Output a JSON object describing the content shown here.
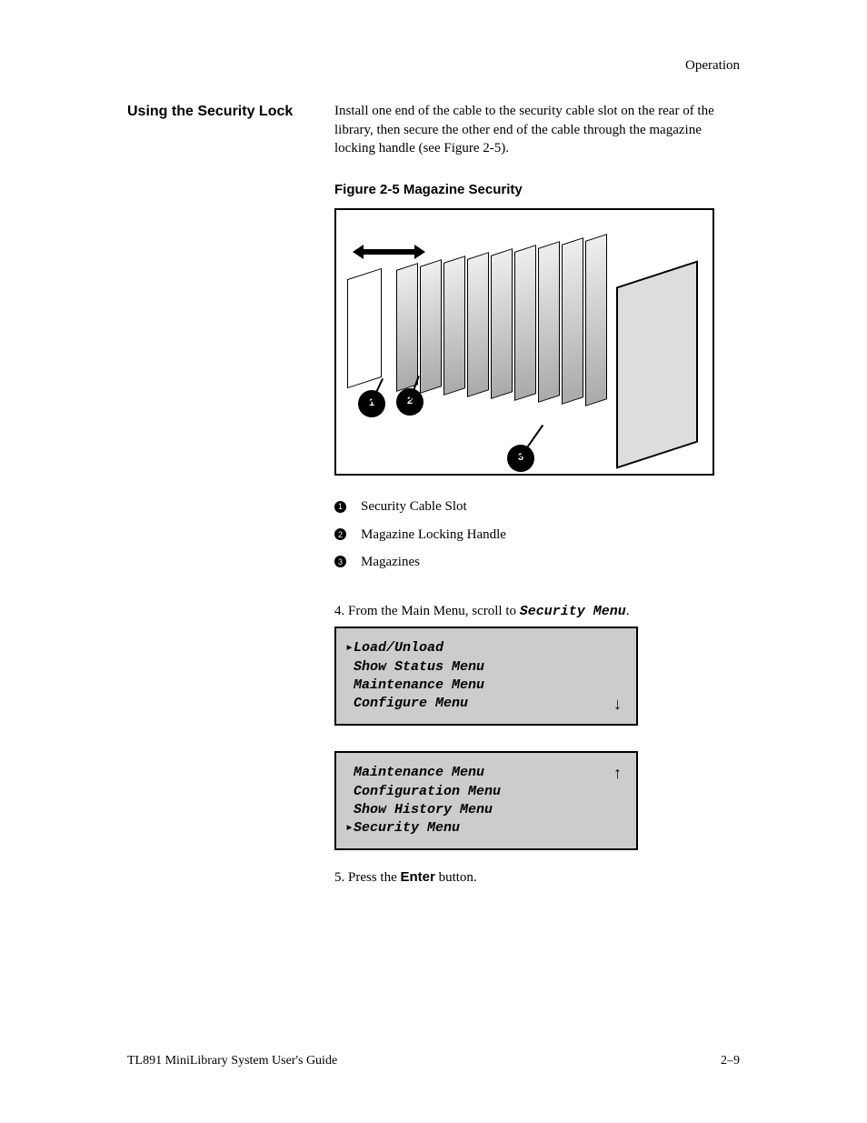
{
  "header": {
    "running_title": "Operation"
  },
  "intro": {
    "heading": "Using the Security Lock",
    "text": "Install one end of the cable to the security cable slot on the rear of the library, then secure the other end of the cable through the magazine locking handle (see Figure 2-5)."
  },
  "figure": {
    "caption": "Figure 2-5 Magazine Security",
    "callouts": [
      {
        "n": "1",
        "label": "Security Cable Slot"
      },
      {
        "n": "2",
        "label": "Magazine Locking Handle"
      },
      {
        "n": "3",
        "label": "Magazines"
      }
    ]
  },
  "steps": {
    "step4": "4.  From the Main Menu, scroll to",
    "step4_target": "Security Menu",
    "step4_tail": ".",
    "menu1": {
      "lines": [
        "Load/Unload",
        "Show Status Menu",
        "Maintenance Menu",
        "Configure Menu"
      ],
      "selected_index": 0,
      "arrow": "down"
    },
    "menu2": {
      "lines": [
        "Maintenance Menu",
        "Configuration Menu",
        "Show History Menu",
        "Security Menu"
      ],
      "selected_index": 3,
      "arrow": "up"
    },
    "step5_prefix": "5.  Press the ",
    "step5_bold": "Enter",
    "step5_suffix": " button."
  },
  "footer": {
    "doc_title": "TL891 MiniLibrary System User's Guide",
    "page": "2–9"
  }
}
